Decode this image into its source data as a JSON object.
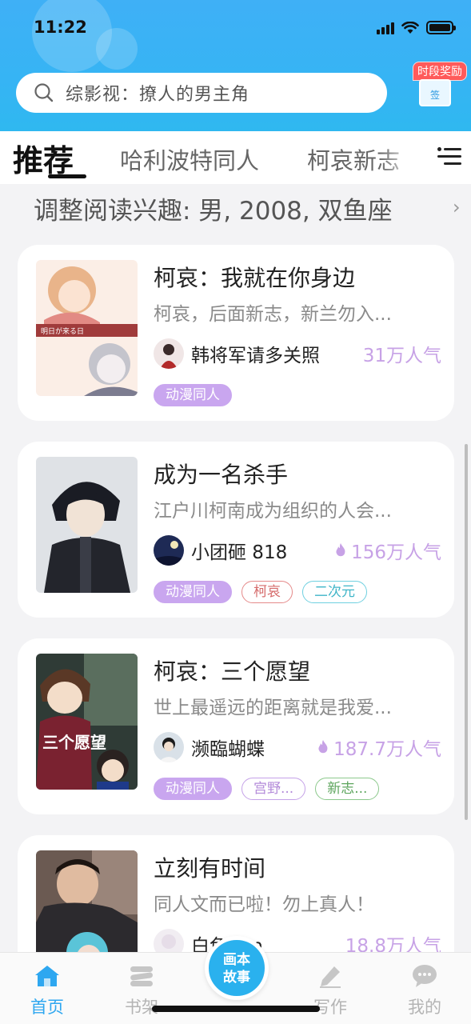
{
  "status_bar": {
    "time": "11:22"
  },
  "search": {
    "placeholder": "综影视：撩人的男主角"
  },
  "reward": {
    "label": "时段奖励",
    "box_text": "签"
  },
  "tabs": [
    {
      "label": "推荐",
      "active": true
    },
    {
      "label": "哈利波特同人"
    },
    {
      "label": "柯哀新志"
    }
  ],
  "interest": {
    "text": "调整阅读兴趣: 男, 2008, 双鱼座",
    "chevron": "›"
  },
  "books": [
    {
      "title": "柯哀：我就在你身边",
      "desc": "柯哀，后面新志，新兰勿入...",
      "author": "韩将军请多关照",
      "popularity": "31万人气",
      "show_flame": false,
      "cover_text": "明日が来る日",
      "tags": [
        {
          "label": "动漫同人",
          "style": "fill"
        }
      ]
    },
    {
      "title": "成为一名杀手",
      "desc": "江户川柯南成为组织的人会...",
      "author": "小团砸 818",
      "popularity": "156万人气",
      "show_flame": true,
      "tags": [
        {
          "label": "动漫同人",
          "style": "fill"
        },
        {
          "label": "柯哀",
          "style": "red"
        },
        {
          "label": "二次元",
          "style": "cyan"
        }
      ]
    },
    {
      "title": "柯哀：三个愿望",
      "desc": "世上最遥远的距离就是我爱...",
      "author": "濒臨蝴蝶",
      "popularity": "187.7万人气",
      "show_flame": true,
      "cover_text": "三个愿望",
      "tags": [
        {
          "label": "动漫同人",
          "style": "fill"
        },
        {
          "label": "宫野...",
          "style": "purple"
        },
        {
          "label": "新志...",
          "style": "green"
        }
      ]
    },
    {
      "title": "立刻有时间",
      "desc": "同人文而已啦！勿上真人！",
      "author": "白色 ...n",
      "popularity": "18.8万人气",
      "show_flame": false,
      "tags": []
    }
  ],
  "bottom_nav": {
    "items": [
      {
        "label": "首页",
        "icon": "home-icon",
        "active": true
      },
      {
        "label": "书架",
        "icon": "bookshelf-icon"
      },
      {
        "label": "写作",
        "icon": "pen-icon"
      },
      {
        "label": "我的",
        "icon": "chat-bubble-icon"
      }
    ],
    "center_button": {
      "line1": "画本",
      "line2": "故事"
    }
  },
  "colors": {
    "header": "#3fb0f6",
    "accent": "#2ea7f0",
    "tag_fill": "#c9a6ef",
    "popularity": "#c7a2e6"
  }
}
